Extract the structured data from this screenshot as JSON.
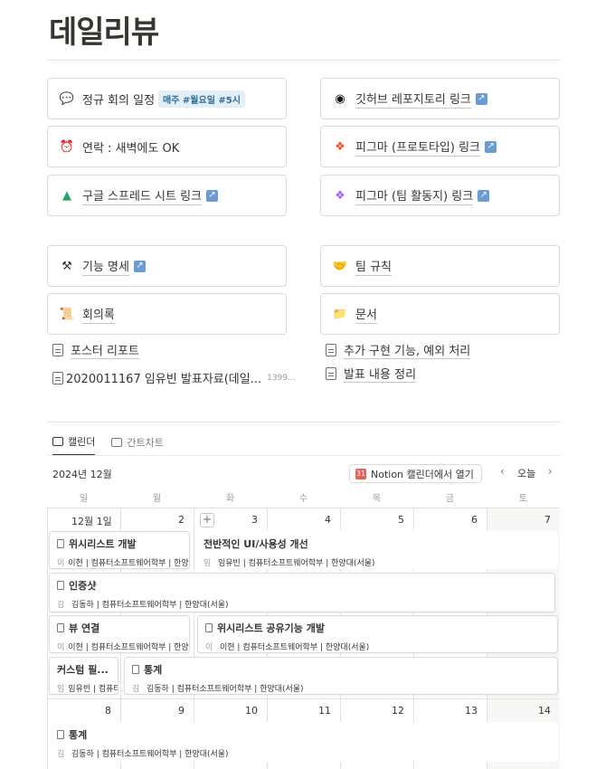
{
  "page": {
    "title": "데일리뷰"
  },
  "top_cards": [
    {
      "icon": "💬",
      "label": "정규 회의 일정",
      "tags": [
        "매주 #월요일 #5시"
      ],
      "link": false,
      "arrow": false
    },
    {
      "icon": "⏰",
      "label": "연락 : 새벽에도 OK",
      "tags": [],
      "link": false,
      "arrow": false
    },
    {
      "icon": "▲",
      "label": "구글 스프레드 시트 링크",
      "tags": [],
      "link": true,
      "arrow": true
    },
    {
      "icon": "◉",
      "label": "깃허브 레포지토리 링크",
      "tags": [],
      "link": true,
      "arrow": true
    },
    {
      "icon": "❖",
      "label": "피그마 (프로토타입) 링크",
      "tags": [],
      "link": true,
      "arrow": true
    },
    {
      "icon": "❖",
      "label": "피그마 (팀 활동지) 링크",
      "tags": [],
      "link": true,
      "arrow": true
    }
  ],
  "mid_cards": [
    {
      "icon": "⚒",
      "label": "기능 명세",
      "arrow": true
    },
    {
      "icon": "🤝",
      "label": "팀 규칙",
      "arrow": false
    },
    {
      "icon": "📜",
      "label": "회의록",
      "arrow": false
    },
    {
      "icon": "📁",
      "label": "문서",
      "arrow": false
    }
  ],
  "pages": [
    {
      "label": "포스터 리포트"
    },
    {
      "label": "2020011167 임유빈 발표자료(데일...",
      "size": "1399..."
    },
    {
      "label": "추가 구현 기능, 예외 처리"
    },
    {
      "label": "발표 내용 정리"
    }
  ],
  "tabs": [
    {
      "label": "캘린더",
      "active": true
    },
    {
      "label": "간트차트",
      "active": false
    }
  ],
  "calendar": {
    "month": "2024년 12월",
    "open_button": "Notion 캘린더에서 열기",
    "today": "오늘",
    "prev": "‹",
    "next": "›",
    "weekdays": [
      "일",
      "월",
      "화",
      "수",
      "목",
      "금",
      "토"
    ],
    "week1_days": [
      "12월 1일",
      "2",
      "3",
      "4",
      "5",
      "6",
      "7"
    ],
    "week2_days": [
      "8",
      "9",
      "10",
      "11",
      "12",
      "13",
      "14"
    ],
    "events": [
      {
        "title": "위시리스트 개발",
        "avatar": "이",
        "person": "이현 | 컴퓨터소프트웨어학부 | 한양대(서울)"
      },
      {
        "title": "전반적인 UI/사용성 개선",
        "avatar": "임",
        "person": "임유빈 | 컴퓨터소프트웨어학부 | 한양대(서울)"
      },
      {
        "title": "인증샷",
        "avatar": "김",
        "person": "김동하 | 컴퓨터소프트웨어학부 | 한양대(서울)"
      },
      {
        "title": "뷰 연결",
        "avatar": "이",
        "person": "이현 | 컴퓨터소프트웨어학부 | 한양대(서울)"
      },
      {
        "title": "위시리스트 공유기능 개발",
        "avatar": "이",
        "person": "이현 | 컴퓨터소프트웨어학부 | 한양대(서울)"
      },
      {
        "title": "커스텀 필...",
        "avatar": "임",
        "person": "임유빈 | 컴퓨터소프트웨어학부 | 한양대(서울)"
      },
      {
        "title": "통계",
        "avatar": "김",
        "person": "김동하 | 컴퓨터소프트웨어학부 | 한양대(서울)"
      },
      {
        "title": "통계",
        "avatar": "김",
        "person": "김동하 | 컴퓨터소프트웨어학부 | 한양대(서울)"
      }
    ]
  }
}
